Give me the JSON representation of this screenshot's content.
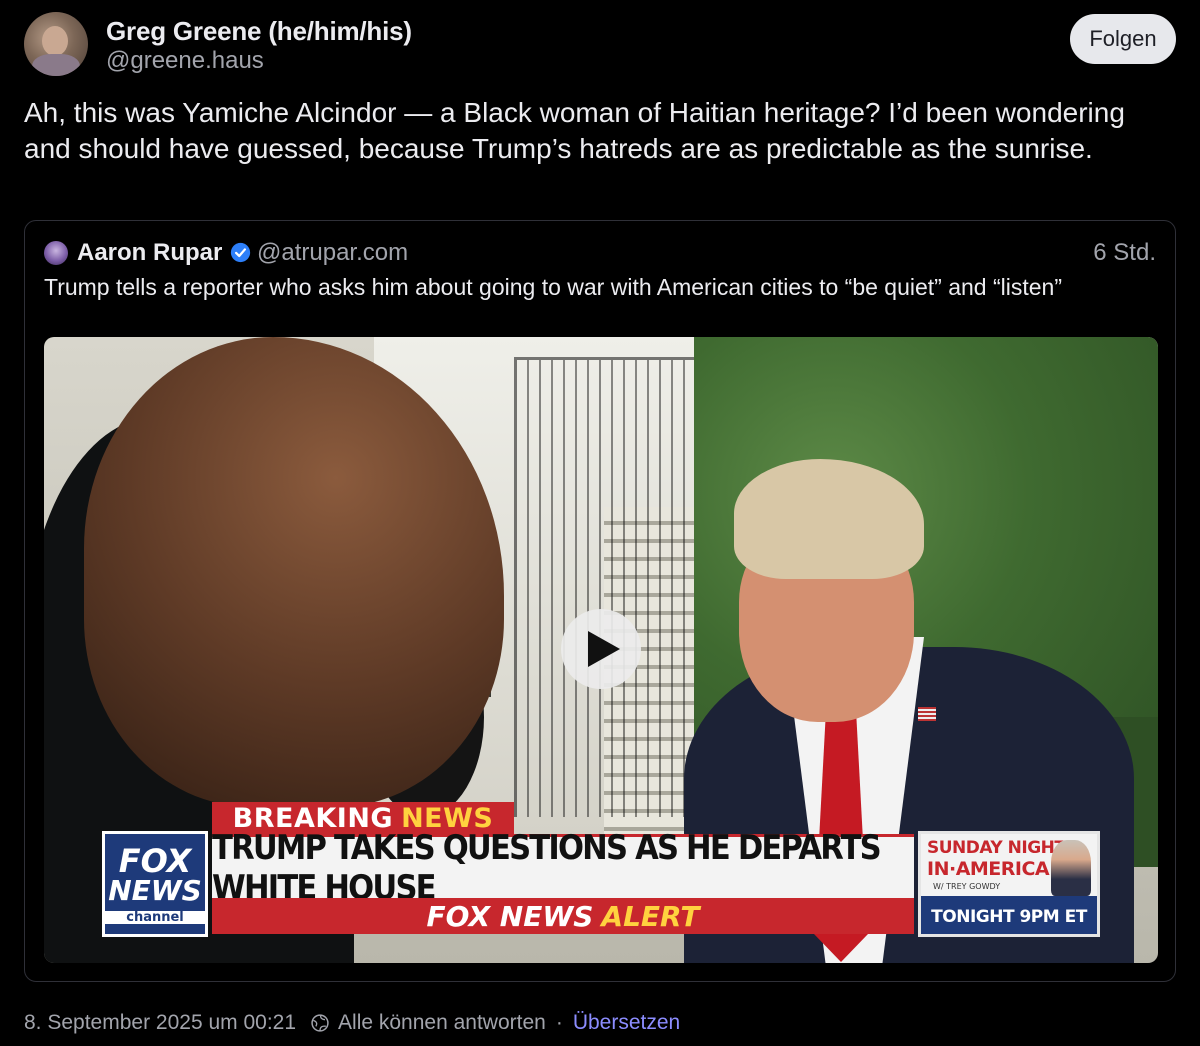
{
  "author": {
    "name": "Greg Greene (he/him/his)",
    "handle": "@greene.haus",
    "avatar_icon": "profile-photo"
  },
  "follow_button": {
    "label": "Folgen"
  },
  "post": {
    "text": "Ah, this was Yamiche Alcindor — a Black woman of Haitian heritage? I’d been wondering and should have guessed, because Trump’s hatreds are as predictable as the sunrise."
  },
  "quote": {
    "name": "Aaron Rupar",
    "verified_icon": "verified-badge-icon",
    "handle": "@atrupar.com",
    "time": "6 Std.",
    "text": "Trump tells a reporter who asks him about going to war with American cities to “be quiet” and “listen”",
    "video": {
      "play_icon": "play-icon",
      "breaking": "BREAKING",
      "news": "NEWS",
      "logo_line1": "FOX",
      "logo_line2": "NEWS",
      "logo_line3": "channel",
      "headline": "TRUMP TAKES QUESTIONS AS HE DEPARTS WHITE HOUSE",
      "alert_prefix": "FOX NEWS",
      "alert_word": "ALERT",
      "promo_line1": "SUNDAY NIGHT",
      "promo_line2": "IN·AMERICA",
      "promo_line3": "W/ TREY GOWDY",
      "promo_time": "TONIGHT 9PM ET"
    }
  },
  "footer": {
    "timestamp": "8. September 2025 um 00:21",
    "reply_icon": "globe-icon",
    "reply_setting": "Alle können antworten",
    "separator": "·",
    "translate": "Übersetzen"
  },
  "colors": {
    "background": "#000000",
    "accent_link": "#8c8dff",
    "verified": "#2d7ff9",
    "fox_red": "#c7272d",
    "fox_blue": "#1e3a7a"
  }
}
